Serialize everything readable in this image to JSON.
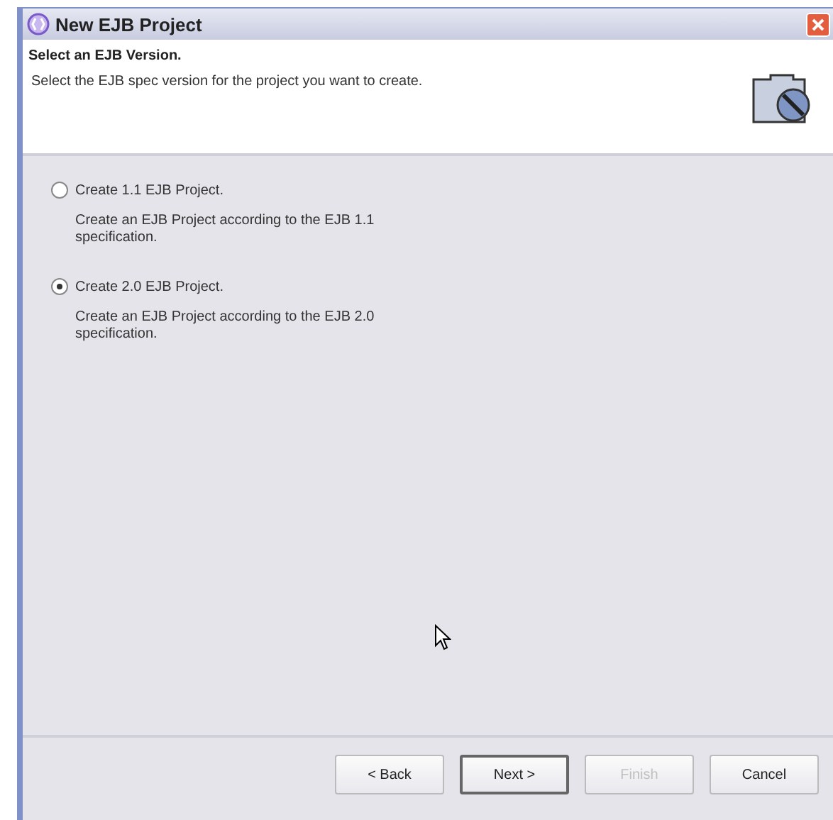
{
  "window": {
    "title": "New EJB Project"
  },
  "header": {
    "title": "Select an EJB Version.",
    "description": "Select the EJB spec version for the project you want to create."
  },
  "options": [
    {
      "label": "Create 1.1 EJB Project.",
      "description": "Create an EJB Project according to the EJB 1.1 specification.",
      "selected": false
    },
    {
      "label": "Create 2.0 EJB Project.",
      "description": "Create an EJB Project according to the EJB 2.0 specification.",
      "selected": true
    }
  ],
  "buttons": [
    {
      "label": "< Back",
      "disabled": false,
      "default": false
    },
    {
      "label": "Next >",
      "disabled": false,
      "default": true
    },
    {
      "label": "Finish",
      "disabled": true,
      "default": false
    },
    {
      "label": "Cancel",
      "disabled": false,
      "default": false
    }
  ]
}
